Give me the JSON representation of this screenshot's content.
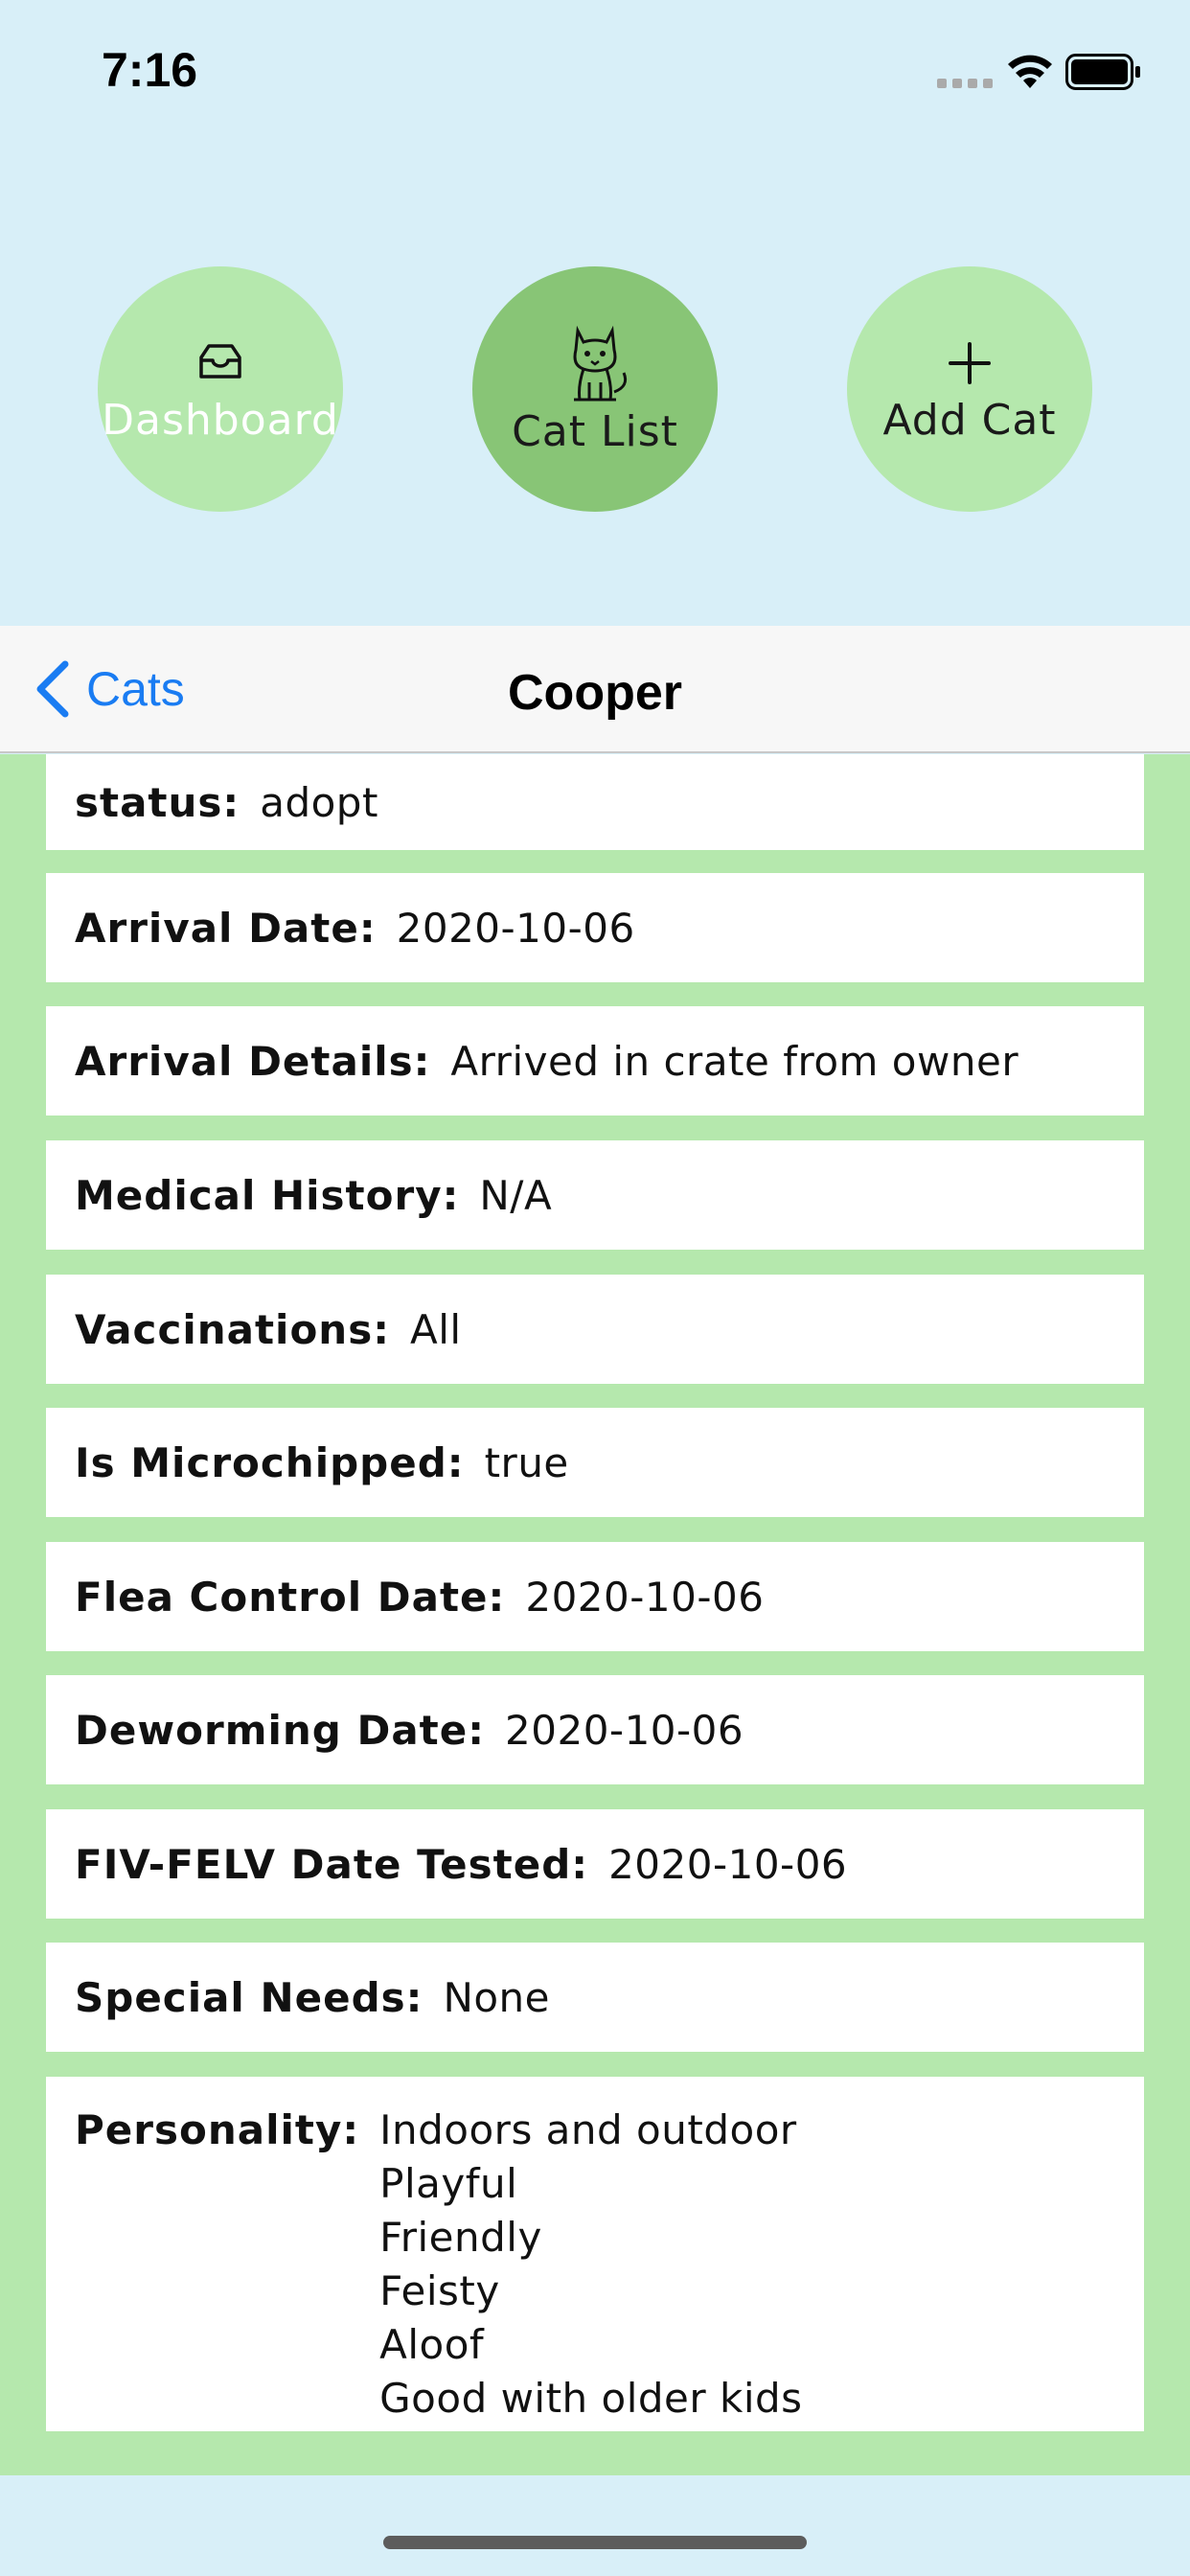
{
  "status_bar": {
    "time": "7:16",
    "icons": [
      "cellular-signal-icon",
      "wifi-icon",
      "battery-icon"
    ]
  },
  "top_nav": {
    "buttons": [
      {
        "label": "Dashboard",
        "icon": "tray-icon",
        "active": false
      },
      {
        "label": "Cat List",
        "icon": "cat-icon",
        "active": true
      },
      {
        "label": "Add Cat",
        "icon": "plus-icon",
        "active": false
      }
    ]
  },
  "nav_bar": {
    "back_label": "Cats",
    "title": "Cooper"
  },
  "fields": [
    {
      "label": "status",
      "value": "adopt"
    },
    {
      "label": "Arrival Date",
      "value": "2020-10-06"
    },
    {
      "label": "Arrival Details",
      "value": "Arrived in crate from owner"
    },
    {
      "label": "Medical History",
      "value": "N/A"
    },
    {
      "label": "Vaccinations",
      "value": "All"
    },
    {
      "label": "Is Microchipped",
      "value": "true"
    },
    {
      "label": "Flea Control Date",
      "value": "2020-10-06"
    },
    {
      "label": "Deworming Date",
      "value": "2020-10-06"
    },
    {
      "label": "FIV-FELV Date Tested",
      "value": "2020-10-06"
    },
    {
      "label": "Special Needs",
      "value": "None"
    }
  ],
  "personality": {
    "label": "Personality",
    "values": [
      "Indoors and outdoor",
      "Playful",
      "Friendly",
      "Feisty",
      "Aloof",
      "Good with older kids"
    ]
  },
  "colors": {
    "background": "#d8eff8",
    "content_green": "#b5e8ad",
    "active_button": "#88c576",
    "ios_blue": "#1a7cf2"
  }
}
